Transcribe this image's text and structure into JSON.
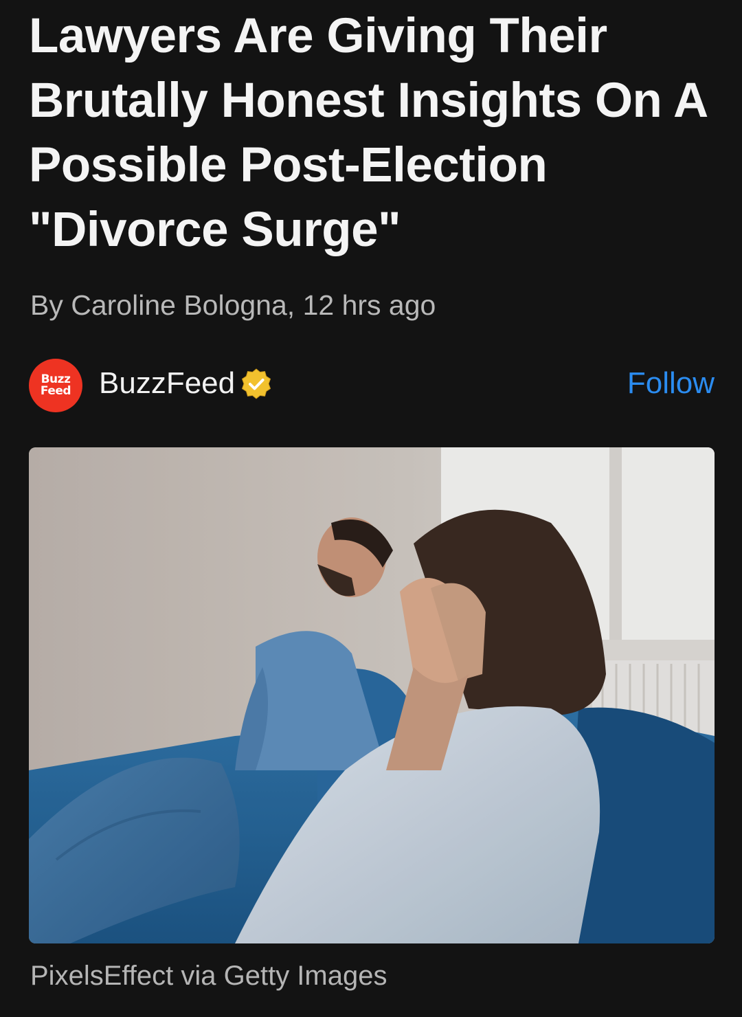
{
  "article": {
    "headline": "Lawyers Are Giving Their Brutally Honest Insights On A Possible Post-Election \"Divorce Surge\"",
    "byline": "By Caroline Bologna, 12 hrs ago",
    "publisher": {
      "logo_text": "Buzz\nFeed",
      "name": "BuzzFeed",
      "verified_icon": "verified-badge-icon",
      "follow_label": "Follow"
    },
    "image": {
      "alt": "Woman covering her face on a blue couch while a man sits turned away behind her",
      "caption": "PixelsEffect via Getty Images"
    }
  },
  "colors": {
    "background": "#131313",
    "headline": "#f4f4f4",
    "byline": "#b9b9b9",
    "follow": "#2b8cf0",
    "logo": "#ee3322",
    "verified": "#f2c12e"
  }
}
